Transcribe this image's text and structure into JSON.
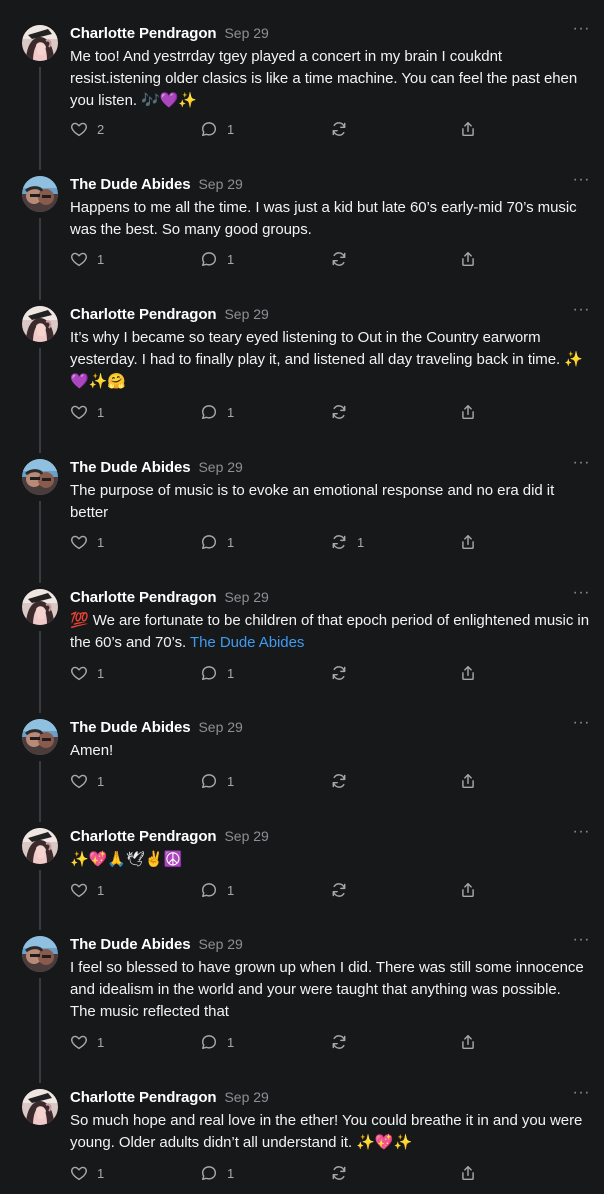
{
  "users": {
    "charlotte": {
      "name": "Charlotte Pendragon"
    },
    "dude": {
      "name": "The Dude Abides"
    }
  },
  "icons": {
    "like": "heart-icon",
    "reply": "comment-bubble-icon",
    "repost": "repost-icon",
    "share": "share-icon",
    "more": "more-horizontal-icon"
  },
  "colors": {
    "background": "#17181a",
    "text": "#f3f3f4",
    "muted": "#8e8f92",
    "mention": "#3f9bf0",
    "thread_line": "#3a3b3e"
  },
  "posts": [
    {
      "author": "Charlotte Pendragon",
      "date": "Sep 29",
      "more": "···",
      "text": "Me too! And yestrrday tgey played a concert in my brain I coukdnt resist.istening older clasics is like a time machine. You can feel the past ehen you listen. 🎶💜✨",
      "likes": "2",
      "replies": "1",
      "reposts": ""
    },
    {
      "author": "The Dude Abides",
      "date": "Sep 29",
      "more": "···",
      "text": "Happens to me all the time. I was just a kid but late 60’s early-mid 70’s music was the best. So many good groups.",
      "likes": "1",
      "replies": "1",
      "reposts": ""
    },
    {
      "author": "Charlotte Pendragon",
      "date": "Sep 29",
      "more": "···",
      "text": "It’s why I became so teary eyed listening to Out in the Country earworm yesterday. I had to finally play it, and listened all day traveling back in time. ✨💜✨🤗",
      "likes": "1",
      "replies": "1",
      "reposts": ""
    },
    {
      "author": "The Dude Abides",
      "date": "Sep 29",
      "more": "···",
      "text": "The purpose of music is to evoke an emotional response and no era did it better",
      "likes": "1",
      "replies": "1",
      "reposts": "1"
    },
    {
      "author": "Charlotte Pendragon",
      "date": "Sep 29",
      "more": "···",
      "text": "💯 We are fortunate to be children of that epoch period of enlightened music in the 60’s and 70’s. ",
      "mention": "The Dude Abides",
      "likes": "1",
      "replies": "1",
      "reposts": ""
    },
    {
      "author": "The Dude Abides",
      "date": "Sep 29",
      "more": "···",
      "text": "Amen!",
      "likes": "1",
      "replies": "1",
      "reposts": ""
    },
    {
      "author": "Charlotte Pendragon",
      "date": "Sep 29",
      "more": "···",
      "text": "✨💖🙏🕊✌️☮️",
      "likes": "1",
      "replies": "1",
      "reposts": ""
    },
    {
      "author": "The Dude Abides",
      "date": "Sep 29",
      "more": "···",
      "text": "I feel so blessed to have grown up when I did. There was still some innocence and idealism in the world and your were taught that anything was possible. The music reflected that",
      "likes": "1",
      "replies": "1",
      "reposts": ""
    },
    {
      "author": "Charlotte Pendragon",
      "date": "Sep 29",
      "more": "···",
      "text": "So much hope and real love in the ether! You could breathe it in and you were young. Older adults didn’t all understand it. ✨💖✨",
      "likes": "1",
      "replies": "1",
      "reposts": ""
    }
  ]
}
